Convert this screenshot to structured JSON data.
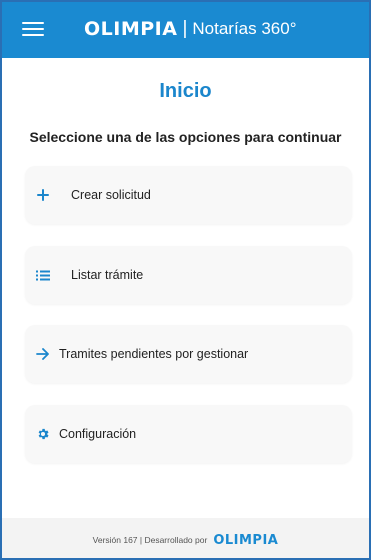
{
  "header": {
    "logo_text": "olimpia",
    "separator": "|",
    "product": "Notarías 360°",
    "menu_icon": "hamburger-menu-icon"
  },
  "main": {
    "title": "Inicio",
    "subtitle": "Seleccione una de las opciones para continuar",
    "options": [
      {
        "label": "Crear solicitud",
        "icon": "plus-icon"
      },
      {
        "label": "Listar trámite",
        "icon": "list-icon"
      },
      {
        "label": "Tramites pendientes por gestionar",
        "icon": "arrow-right-icon"
      },
      {
        "label": "Configuración",
        "icon": "gear-icon"
      }
    ]
  },
  "footer": {
    "text": "Versión 167 | Desarrollado por",
    "logo_text": "olimpia"
  },
  "colors": {
    "brand": "#1a8ad1",
    "title": "#1b86cc",
    "frame": "#2a6fb4"
  }
}
